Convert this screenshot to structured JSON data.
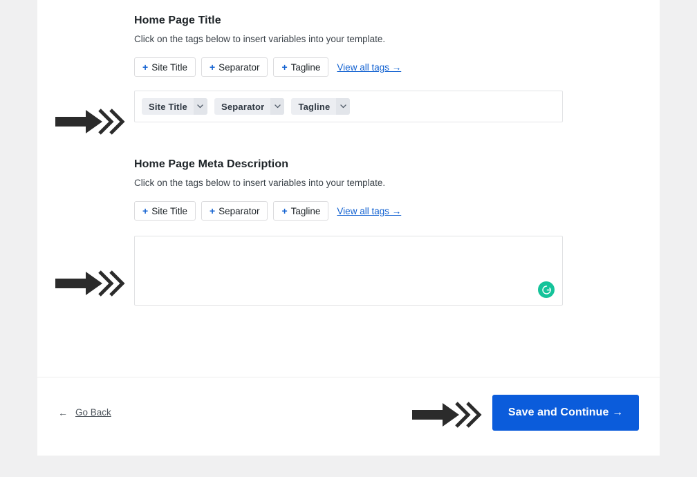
{
  "page": {
    "background_color": "#f0f0f1",
    "card_background": "#ffffff"
  },
  "colors": {
    "accent_blue": "#0b5cdb",
    "link_blue": "#1161d1",
    "heading": "#1d2327",
    "body_text": "#3c434a",
    "grammarly_green": "#15c39a",
    "annotation_black": "#2b2b2b"
  },
  "sections": [
    {
      "id": "home-page-title",
      "title": "Home Page Title",
      "description": "Click on the tags below to insert variables into your template.",
      "tag_buttons": [
        {
          "plus": "+",
          "label": "Site Title"
        },
        {
          "plus": "+",
          "label": "Separator"
        },
        {
          "plus": "+",
          "label": "Tagline"
        }
      ],
      "view_all_link": "View all tags →",
      "field_type": "chips-input",
      "chips": [
        {
          "label": "Site Title",
          "caret": "chevron-down"
        },
        {
          "label": "Separator",
          "caret": "chevron-down"
        },
        {
          "label": "Tagline",
          "caret": "chevron-down"
        }
      ]
    },
    {
      "id": "home-page-meta-description",
      "title": "Home Page Meta Description",
      "description": "Click on the tags below to insert variables into your template.",
      "tag_buttons": [
        {
          "plus": "+",
          "label": "Site Title"
        },
        {
          "plus": "+",
          "label": "Separator"
        },
        {
          "plus": "+",
          "label": "Tagline"
        }
      ],
      "view_all_link": "View all tags →",
      "field_type": "textarea",
      "textarea_value": "",
      "textarea_placeholder": "",
      "grammarly_badge": "grammarly-icon"
    }
  ],
  "footer": {
    "back_arrow": "←",
    "back_label": "Go Back",
    "save_label": "Save and Continue →"
  },
  "annotations": [
    {
      "name": "arrow-to-title-field",
      "points_to": "home-page-title-template-input"
    },
    {
      "name": "arrow-to-meta-field",
      "points_to": "home-page-meta-textarea"
    },
    {
      "name": "arrow-to-save-button",
      "points_to": "save-and-continue-button"
    }
  ]
}
